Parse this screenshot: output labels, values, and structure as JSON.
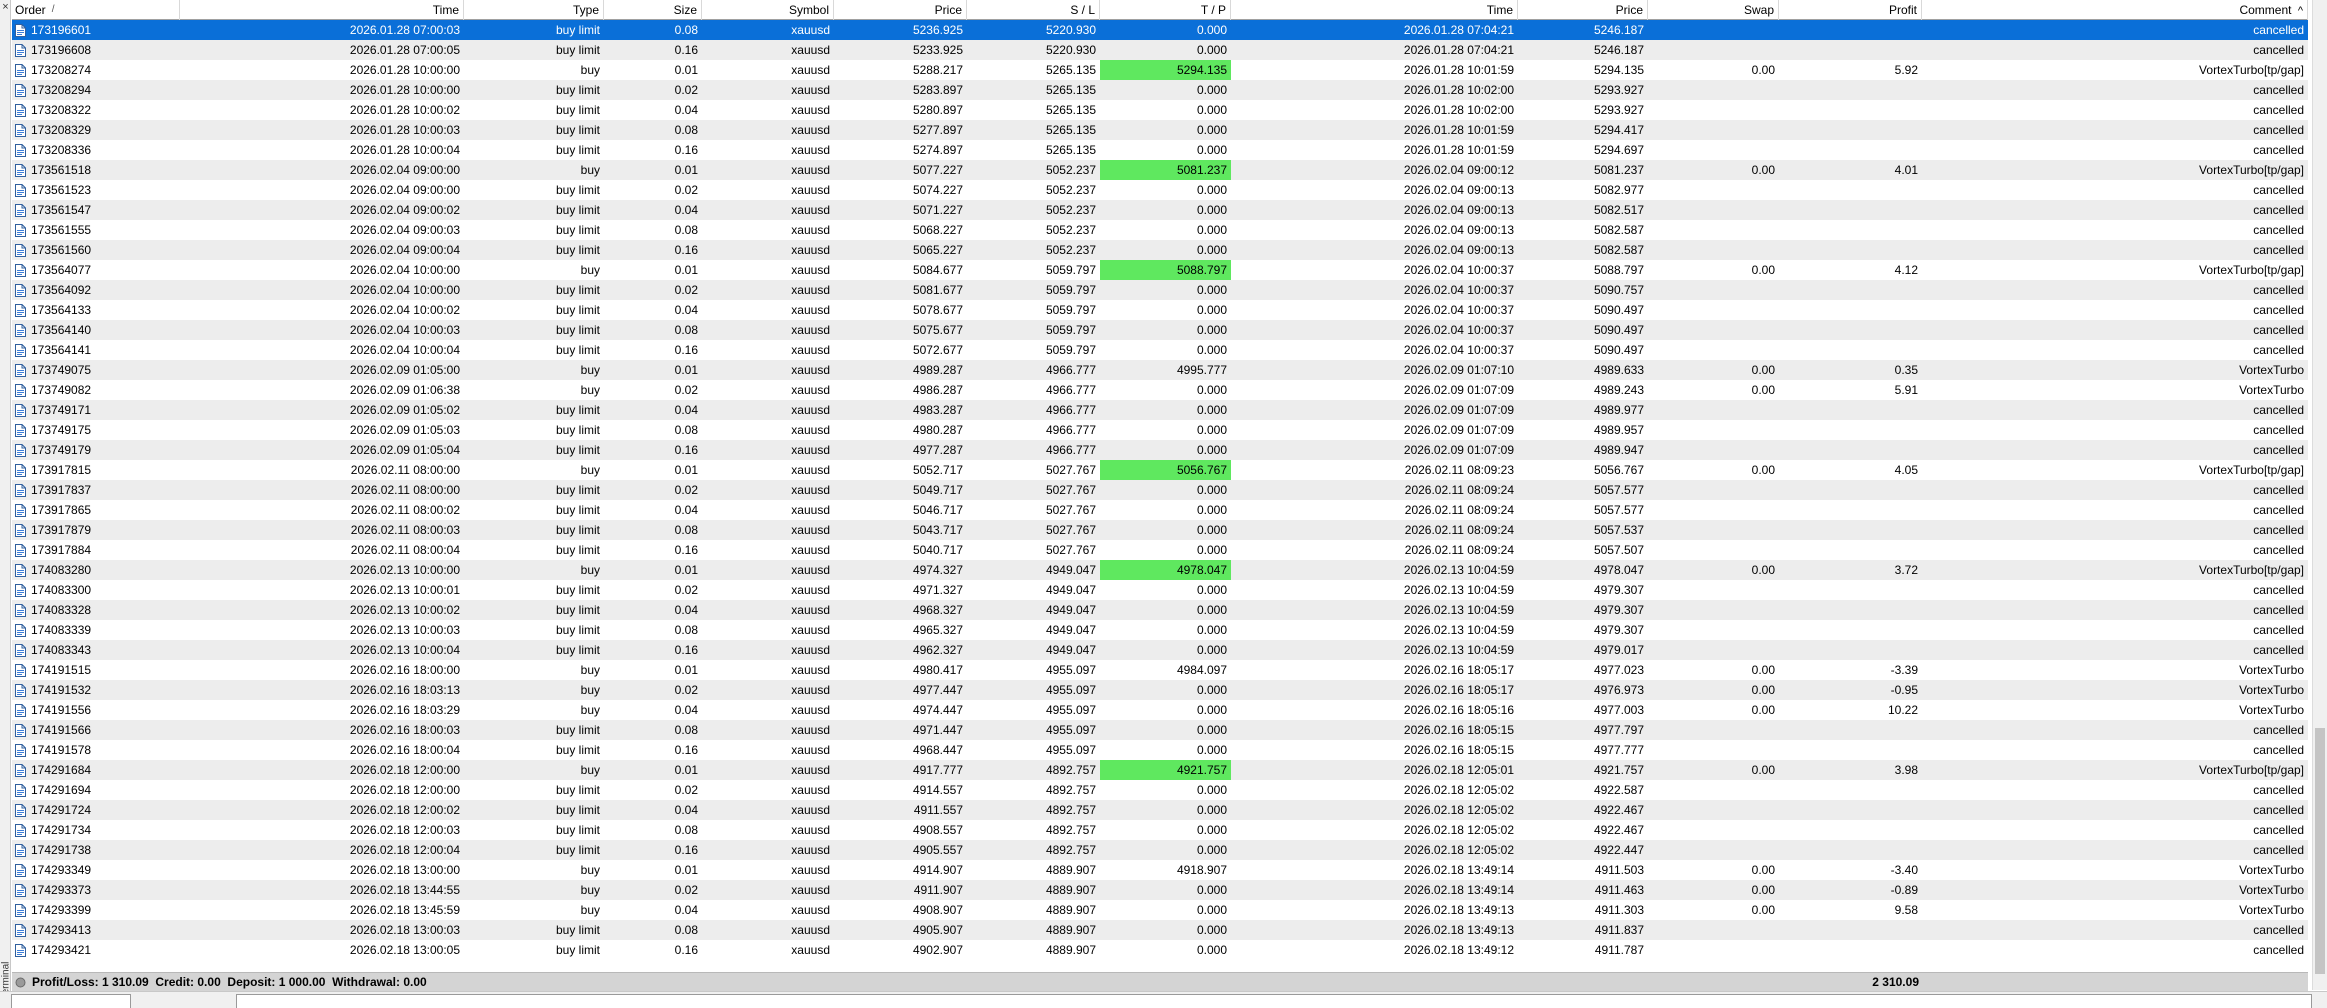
{
  "window": {
    "side_label": "Terminal"
  },
  "columns": {
    "order": "Order",
    "time": "Time",
    "type": "Type",
    "size": "Size",
    "symbol": "Symbol",
    "price": "Price",
    "sl": "S / L",
    "tp": "T / P",
    "time2": "Time",
    "price2": "Price",
    "swap": "Swap",
    "profit": "Profit",
    "comment": "Comment"
  },
  "rows": [
    [
      "173196601",
      "2026.01.28 07:00:03",
      "buy limit",
      "0.08",
      "xauusd",
      "5236.925",
      "5220.930",
      "0.000",
      "2026.01.28 07:04:21",
      "5246.187",
      "",
      "",
      "cancelled"
    ],
    [
      "173196608",
      "2026.01.28 07:00:05",
      "buy limit",
      "0.16",
      "xauusd",
      "5233.925",
      "5220.930",
      "0.000",
      "2026.01.28 07:04:21",
      "5246.187",
      "",
      "",
      "cancelled"
    ],
    [
      "173208274",
      "2026.01.28 10:00:00",
      "buy",
      "0.01",
      "xauusd",
      "5288.217",
      "5265.135",
      "5294.135",
      "2026.01.28 10:01:59",
      "5294.135",
      "0.00",
      "5.92",
      "VortexTurbo[tp/gap]"
    ],
    [
      "173208294",
      "2026.01.28 10:00:00",
      "buy limit",
      "0.02",
      "xauusd",
      "5283.897",
      "5265.135",
      "0.000",
      "2026.01.28 10:02:00",
      "5293.927",
      "",
      "",
      "cancelled"
    ],
    [
      "173208322",
      "2026.01.28 10:00:02",
      "buy limit",
      "0.04",
      "xauusd",
      "5280.897",
      "5265.135",
      "0.000",
      "2026.01.28 10:02:00",
      "5293.927",
      "",
      "",
      "cancelled"
    ],
    [
      "173208329",
      "2026.01.28 10:00:03",
      "buy limit",
      "0.08",
      "xauusd",
      "5277.897",
      "5265.135",
      "0.000",
      "2026.01.28 10:01:59",
      "5294.417",
      "",
      "",
      "cancelled"
    ],
    [
      "173208336",
      "2026.01.28 10:00:04",
      "buy limit",
      "0.16",
      "xauusd",
      "5274.897",
      "5265.135",
      "0.000",
      "2026.01.28 10:01:59",
      "5294.697",
      "",
      "",
      "cancelled"
    ],
    [
      "173561518",
      "2026.02.04 09:00:00",
      "buy",
      "0.01",
      "xauusd",
      "5077.227",
      "5052.237",
      "5081.237",
      "2026.02.04 09:00:12",
      "5081.237",
      "0.00",
      "4.01",
      "VortexTurbo[tp/gap]"
    ],
    [
      "173561523",
      "2026.02.04 09:00:00",
      "buy limit",
      "0.02",
      "xauusd",
      "5074.227",
      "5052.237",
      "0.000",
      "2026.02.04 09:00:13",
      "5082.977",
      "",
      "",
      "cancelled"
    ],
    [
      "173561547",
      "2026.02.04 09:00:02",
      "buy limit",
      "0.04",
      "xauusd",
      "5071.227",
      "5052.237",
      "0.000",
      "2026.02.04 09:00:13",
      "5082.517",
      "",
      "",
      "cancelled"
    ],
    [
      "173561555",
      "2026.02.04 09:00:03",
      "buy limit",
      "0.08",
      "xauusd",
      "5068.227",
      "5052.237",
      "0.000",
      "2026.02.04 09:00:13",
      "5082.587",
      "",
      "",
      "cancelled"
    ],
    [
      "173561560",
      "2026.02.04 09:00:04",
      "buy limit",
      "0.16",
      "xauusd",
      "5065.227",
      "5052.237",
      "0.000",
      "2026.02.04 09:00:13",
      "5082.587",
      "",
      "",
      "cancelled"
    ],
    [
      "173564077",
      "2026.02.04 10:00:00",
      "buy",
      "0.01",
      "xauusd",
      "5084.677",
      "5059.797",
      "5088.797",
      "2026.02.04 10:00:37",
      "5088.797",
      "0.00",
      "4.12",
      "VortexTurbo[tp/gap]"
    ],
    [
      "173564092",
      "2026.02.04 10:00:00",
      "buy limit",
      "0.02",
      "xauusd",
      "5081.677",
      "5059.797",
      "0.000",
      "2026.02.04 10:00:37",
      "5090.757",
      "",
      "",
      "cancelled"
    ],
    [
      "173564133",
      "2026.02.04 10:00:02",
      "buy limit",
      "0.04",
      "xauusd",
      "5078.677",
      "5059.797",
      "0.000",
      "2026.02.04 10:00:37",
      "5090.497",
      "",
      "",
      "cancelled"
    ],
    [
      "173564140",
      "2026.02.04 10:00:03",
      "buy limit",
      "0.08",
      "xauusd",
      "5075.677",
      "5059.797",
      "0.000",
      "2026.02.04 10:00:37",
      "5090.497",
      "",
      "",
      "cancelled"
    ],
    [
      "173564141",
      "2026.02.04 10:00:04",
      "buy limit",
      "0.16",
      "xauusd",
      "5072.677",
      "5059.797",
      "0.000",
      "2026.02.04 10:00:37",
      "5090.497",
      "",
      "",
      "cancelled"
    ],
    [
      "173749075",
      "2026.02.09 01:05:00",
      "buy",
      "0.01",
      "xauusd",
      "4989.287",
      "4966.777",
      "4995.777",
      "2026.02.09 01:07:10",
      "4989.633",
      "0.00",
      "0.35",
      "VortexTurbo"
    ],
    [
      "173749082",
      "2026.02.09 01:06:38",
      "buy",
      "0.02",
      "xauusd",
      "4986.287",
      "4966.777",
      "0.000",
      "2026.02.09 01:07:09",
      "4989.243",
      "0.00",
      "5.91",
      "VortexTurbo"
    ],
    [
      "173749171",
      "2026.02.09 01:05:02",
      "buy limit",
      "0.04",
      "xauusd",
      "4983.287",
      "4966.777",
      "0.000",
      "2026.02.09 01:07:09",
      "4989.977",
      "",
      "",
      "cancelled"
    ],
    [
      "173749175",
      "2026.02.09 01:05:03",
      "buy limit",
      "0.08",
      "xauusd",
      "4980.287",
      "4966.777",
      "0.000",
      "2026.02.09 01:07:09",
      "4989.957",
      "",
      "",
      "cancelled"
    ],
    [
      "173749179",
      "2026.02.09 01:05:04",
      "buy limit",
      "0.16",
      "xauusd",
      "4977.287",
      "4966.777",
      "0.000",
      "2026.02.09 01:07:09",
      "4989.947",
      "",
      "",
      "cancelled"
    ],
    [
      "173917815",
      "2026.02.11 08:00:00",
      "buy",
      "0.01",
      "xauusd",
      "5052.717",
      "5027.767",
      "5056.767",
      "2026.02.11 08:09:23",
      "5056.767",
      "0.00",
      "4.05",
      "VortexTurbo[tp/gap]"
    ],
    [
      "173917837",
      "2026.02.11 08:00:00",
      "buy limit",
      "0.02",
      "xauusd",
      "5049.717",
      "5027.767",
      "0.000",
      "2026.02.11 08:09:24",
      "5057.577",
      "",
      "",
      "cancelled"
    ],
    [
      "173917865",
      "2026.02.11 08:00:02",
      "buy limit",
      "0.04",
      "xauusd",
      "5046.717",
      "5027.767",
      "0.000",
      "2026.02.11 08:09:24",
      "5057.577",
      "",
      "",
      "cancelled"
    ],
    [
      "173917879",
      "2026.02.11 08:00:03",
      "buy limit",
      "0.08",
      "xauusd",
      "5043.717",
      "5027.767",
      "0.000",
      "2026.02.11 08:09:24",
      "5057.537",
      "",
      "",
      "cancelled"
    ],
    [
      "173917884",
      "2026.02.11 08:00:04",
      "buy limit",
      "0.16",
      "xauusd",
      "5040.717",
      "5027.767",
      "0.000",
      "2026.02.11 08:09:24",
      "5057.507",
      "",
      "",
      "cancelled"
    ],
    [
      "174083280",
      "2026.02.13 10:00:00",
      "buy",
      "0.01",
      "xauusd",
      "4974.327",
      "4949.047",
      "4978.047",
      "2026.02.13 10:04:59",
      "4978.047",
      "0.00",
      "3.72",
      "VortexTurbo[tp/gap]"
    ],
    [
      "174083300",
      "2026.02.13 10:00:01",
      "buy limit",
      "0.02",
      "xauusd",
      "4971.327",
      "4949.047",
      "0.000",
      "2026.02.13 10:04:59",
      "4979.307",
      "",
      "",
      "cancelled"
    ],
    [
      "174083328",
      "2026.02.13 10:00:02",
      "buy limit",
      "0.04",
      "xauusd",
      "4968.327",
      "4949.047",
      "0.000",
      "2026.02.13 10:04:59",
      "4979.307",
      "",
      "",
      "cancelled"
    ],
    [
      "174083339",
      "2026.02.13 10:00:03",
      "buy limit",
      "0.08",
      "xauusd",
      "4965.327",
      "4949.047",
      "0.000",
      "2026.02.13 10:04:59",
      "4979.307",
      "",
      "",
      "cancelled"
    ],
    [
      "174083343",
      "2026.02.13 10:00:04",
      "buy limit",
      "0.16",
      "xauusd",
      "4962.327",
      "4949.047",
      "0.000",
      "2026.02.13 10:04:59",
      "4979.017",
      "",
      "",
      "cancelled"
    ],
    [
      "174191515",
      "2026.02.16 18:00:00",
      "buy",
      "0.01",
      "xauusd",
      "4980.417",
      "4955.097",
      "4984.097",
      "2026.02.16 18:05:17",
      "4977.023",
      "0.00",
      "-3.39",
      "VortexTurbo"
    ],
    [
      "174191532",
      "2026.02.16 18:03:13",
      "buy",
      "0.02",
      "xauusd",
      "4977.447",
      "4955.097",
      "0.000",
      "2026.02.16 18:05:17",
      "4976.973",
      "0.00",
      "-0.95",
      "VortexTurbo"
    ],
    [
      "174191556",
      "2026.02.16 18:03:29",
      "buy",
      "0.04",
      "xauusd",
      "4974.447",
      "4955.097",
      "0.000",
      "2026.02.16 18:05:16",
      "4977.003",
      "0.00",
      "10.22",
      "VortexTurbo"
    ],
    [
      "174191566",
      "2026.02.16 18:00:03",
      "buy limit",
      "0.08",
      "xauusd",
      "4971.447",
      "4955.097",
      "0.000",
      "2026.02.16 18:05:15",
      "4977.797",
      "",
      "",
      "cancelled"
    ],
    [
      "174191578",
      "2026.02.16 18:00:04",
      "buy limit",
      "0.16",
      "xauusd",
      "4968.447",
      "4955.097",
      "0.000",
      "2026.02.16 18:05:15",
      "4977.777",
      "",
      "",
      "cancelled"
    ],
    [
      "174291684",
      "2026.02.18 12:00:00",
      "buy",
      "0.01",
      "xauusd",
      "4917.777",
      "4892.757",
      "4921.757",
      "2026.02.18 12:05:01",
      "4921.757",
      "0.00",
      "3.98",
      "VortexTurbo[tp/gap]"
    ],
    [
      "174291694",
      "2026.02.18 12:00:00",
      "buy limit",
      "0.02",
      "xauusd",
      "4914.557",
      "4892.757",
      "0.000",
      "2026.02.18 12:05:02",
      "4922.587",
      "",
      "",
      "cancelled"
    ],
    [
      "174291724",
      "2026.02.18 12:00:02",
      "buy limit",
      "0.04",
      "xauusd",
      "4911.557",
      "4892.757",
      "0.000",
      "2026.02.18 12:05:02",
      "4922.467",
      "",
      "",
      "cancelled"
    ],
    [
      "174291734",
      "2026.02.18 12:00:03",
      "buy limit",
      "0.08",
      "xauusd",
      "4908.557",
      "4892.757",
      "0.000",
      "2026.02.18 12:05:02",
      "4922.467",
      "",
      "",
      "cancelled"
    ],
    [
      "174291738",
      "2026.02.18 12:00:04",
      "buy limit",
      "0.16",
      "xauusd",
      "4905.557",
      "4892.757",
      "0.000",
      "2026.02.18 12:05:02",
      "4922.447",
      "",
      "",
      "cancelled"
    ],
    [
      "174293349",
      "2026.02.18 13:00:00",
      "buy",
      "0.01",
      "xauusd",
      "4914.907",
      "4889.907",
      "4918.907",
      "2026.02.18 13:49:14",
      "4911.503",
      "0.00",
      "-3.40",
      "VortexTurbo"
    ],
    [
      "174293373",
      "2026.02.18 13:44:55",
      "buy",
      "0.02",
      "xauusd",
      "4911.907",
      "4889.907",
      "0.000",
      "2026.02.18 13:49:14",
      "4911.463",
      "0.00",
      "-0.89",
      "VortexTurbo"
    ],
    [
      "174293399",
      "2026.02.18 13:45:59",
      "buy",
      "0.04",
      "xauusd",
      "4908.907",
      "4889.907",
      "0.000",
      "2026.02.18 13:49:13",
      "4911.303",
      "0.00",
      "9.58",
      "VortexTurbo"
    ],
    [
      "174293413",
      "2026.02.18 13:00:03",
      "buy limit",
      "0.08",
      "xauusd",
      "4905.907",
      "4889.907",
      "0.000",
      "2026.02.18 13:49:13",
      "4911.837",
      "",
      "",
      "cancelled"
    ],
    [
      "174293421",
      "2026.02.18 13:00:05",
      "buy limit",
      "0.16",
      "xauusd",
      "4902.907",
      "4889.907",
      "0.000",
      "2026.02.18 13:49:12",
      "4911.787",
      "",
      "",
      "cancelled"
    ]
  ],
  "highlight_tp_rows": [
    "173208274",
    "173561518",
    "173564077",
    "173917815",
    "174083280",
    "174291684"
  ],
  "selected_order": "173196601",
  "footer": {
    "summary": "Profit/Loss: 1 310.09  Credit: 0.00  Deposit: 1 000.00  Withdrawal: 0.00",
    "profit_total": "2 310.09"
  },
  "icons": {
    "row_icon": "document-icon",
    "footer_icon": "balance-icon"
  },
  "colors": {
    "selected_row": "#0a6fd8",
    "tp_highlight": "#5fe85f",
    "alt_row": "#ededed",
    "footer_bg": "#d4d4d4"
  }
}
